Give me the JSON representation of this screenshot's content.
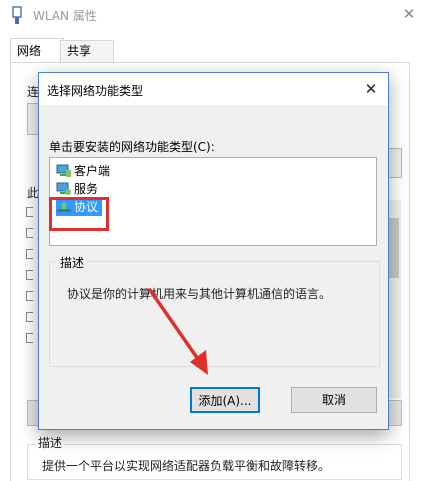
{
  "parent_window": {
    "title": "WLAN 属性",
    "close_glyph": "✕",
    "tabs": [
      {
        "label": "网络"
      },
      {
        "label": "共享"
      }
    ],
    "fragments": {
      "connect_using_partial": "连",
      "this_connection_partial": "此"
    },
    "description_label": "描述",
    "description_text": "提供一个平台以实现网络适配器负载平衡和故障转移。"
  },
  "dialog": {
    "title": "选择网络功能类型",
    "close_glyph": "✕",
    "list_label": "单击要安装的网络功能类型(C):",
    "items": [
      {
        "label": "客户端",
        "icon": "client-icon"
      },
      {
        "label": "服务",
        "icon": "service-icon"
      },
      {
        "label": "协议",
        "icon": "protocol-icon",
        "selected": true
      }
    ],
    "description_label": "描述",
    "description_text": "协议是你的计算机用来与其他计算机通信的语言。",
    "buttons": {
      "add": "添加(A)...",
      "cancel": "取消"
    }
  },
  "colors": {
    "selection": "#3399ff",
    "annotation_red": "#e0302a",
    "default_button_border": "#0078d7"
  }
}
